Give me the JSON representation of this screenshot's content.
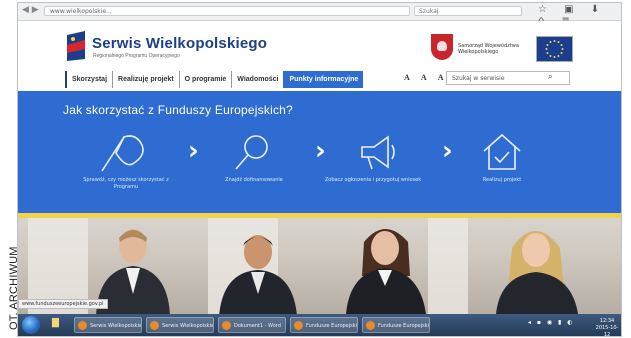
{
  "credit": "OT. ARCHIWUM",
  "browser": {
    "url": "www.wielkopolskie...",
    "search_placeholder": "Szukaj"
  },
  "site": {
    "title": "Serwis Wielkopolskiego",
    "subtitle": "Regionalnego Programu Operacyjnego",
    "crest_text": "Samorząd Województwa Wielkopolskiego"
  },
  "menu": {
    "items": [
      {
        "label": "Skorzystaj"
      },
      {
        "label": "Realizuję projekt"
      },
      {
        "label": "O programie"
      },
      {
        "label": "Wiadomości"
      },
      {
        "label": "Punkty informacyjne",
        "active": true
      }
    ],
    "font_sizes": "A A A",
    "search_placeholder": "Szukaj w serwisie"
  },
  "hero": {
    "title": "Jak skorzystać z Funduszy Europejskich?",
    "steps": [
      {
        "icon": "flag-icon",
        "label": "Sprawdź, czy możesz skorzystać z Programu"
      },
      {
        "icon": "magnifier-icon",
        "label": "Znajdź dofinansowanie"
      },
      {
        "icon": "megaphone-icon",
        "label": "Zobacz ogłoszenia i przygotuj wniosek"
      },
      {
        "icon": "house-icon",
        "label": "Realizuj projekt"
      }
    ]
  },
  "photo": {
    "status_url": "www.funduszeeuropejskie.gov.pl"
  },
  "taskbar": {
    "items": [
      {
        "label": "Serwis Wielkopolskiego"
      },
      {
        "label": "Serwis Wielkopolskiego"
      },
      {
        "label": "Dokument1 - Word"
      },
      {
        "label": "Fundusze Europejskie"
      },
      {
        "label": "Fundusze Europejskie"
      }
    ],
    "time": "12:34",
    "date": "2015-10-12"
  },
  "colors": {
    "brand_blue": "#2e6cd1",
    "title_navy": "#1d3f87",
    "accent_yellow": "#f2d14b"
  }
}
